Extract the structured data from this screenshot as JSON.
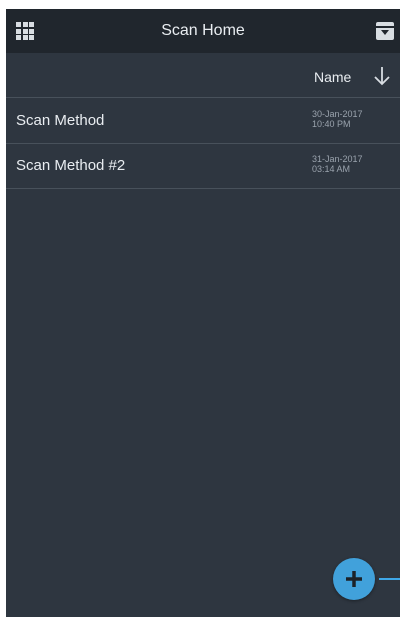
{
  "header": {
    "title": "Scan Home",
    "left_icon": "apps-grid-icon",
    "right_icon": "archive-icon"
  },
  "sort": {
    "label": "Name",
    "direction_icon": "arrow-down-icon"
  },
  "items": [
    {
      "name": "Scan Method",
      "date": "30-Jan-2017",
      "time": "10:40 PM"
    },
    {
      "name": "Scan Method #2",
      "date": "31-Jan-2017",
      "time": "03:14 AM"
    }
  ],
  "fab": {
    "icon": "plus-icon",
    "color": "#41a1db"
  },
  "colors": {
    "background": "#2e3640",
    "toolbar": "#20262d",
    "accent": "#41a1db"
  }
}
